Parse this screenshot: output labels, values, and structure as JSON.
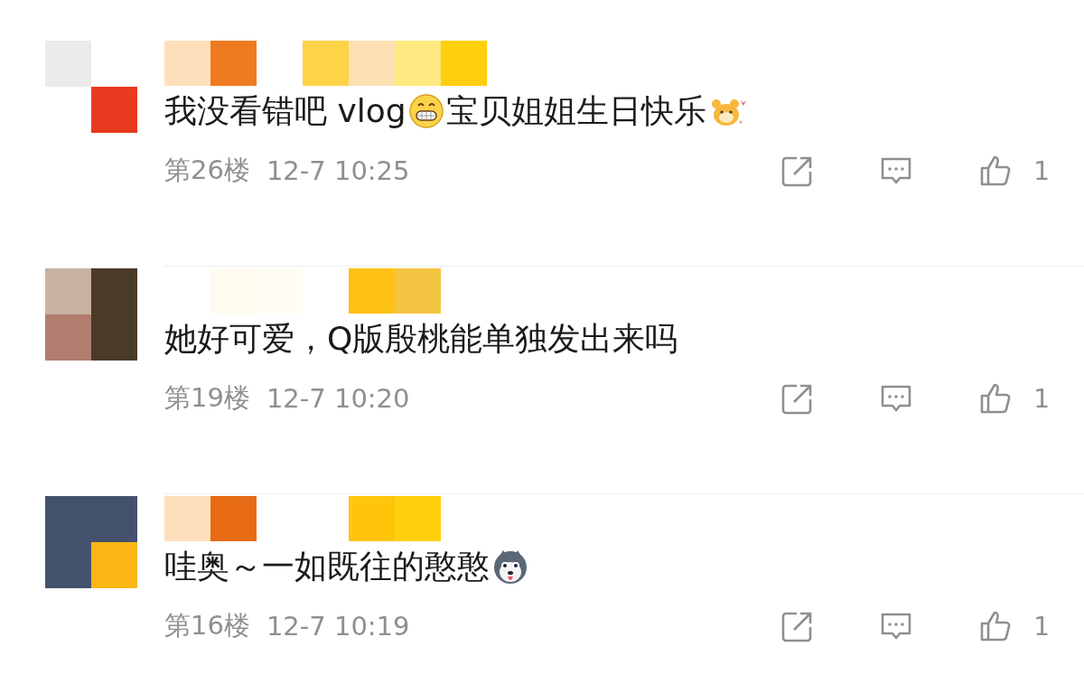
{
  "comments": [
    {
      "avatar": {
        "kind": "picture"
      },
      "content": [
        {
          "kind": "text",
          "text": "我没看错吧 vlog"
        },
        {
          "kind": "grin"
        },
        {
          "kind": "text",
          "text": " 宝贝姐姐生日快乐"
        },
        {
          "kind": "hamster"
        }
      ],
      "floor": "第26楼",
      "time": "12-7 10:25",
      "likes": "1"
    },
    {
      "avatar": {
        "kind": "picture"
      },
      "content": [
        {
          "kind": "text",
          "text": "她好可爱，Q版殷桃能单独发出来吗"
        }
      ],
      "floor": "第19楼",
      "time": "12-7 10:20",
      "likes": "1"
    },
    {
      "avatar": {
        "kind": "picture"
      },
      "content": [
        {
          "kind": "text",
          "text": "哇奥～一如既往的憨憨"
        },
        {
          "kind": "dog"
        }
      ],
      "floor": "第16楼",
      "time": "12-7 10:19",
      "likes": "1"
    }
  ]
}
